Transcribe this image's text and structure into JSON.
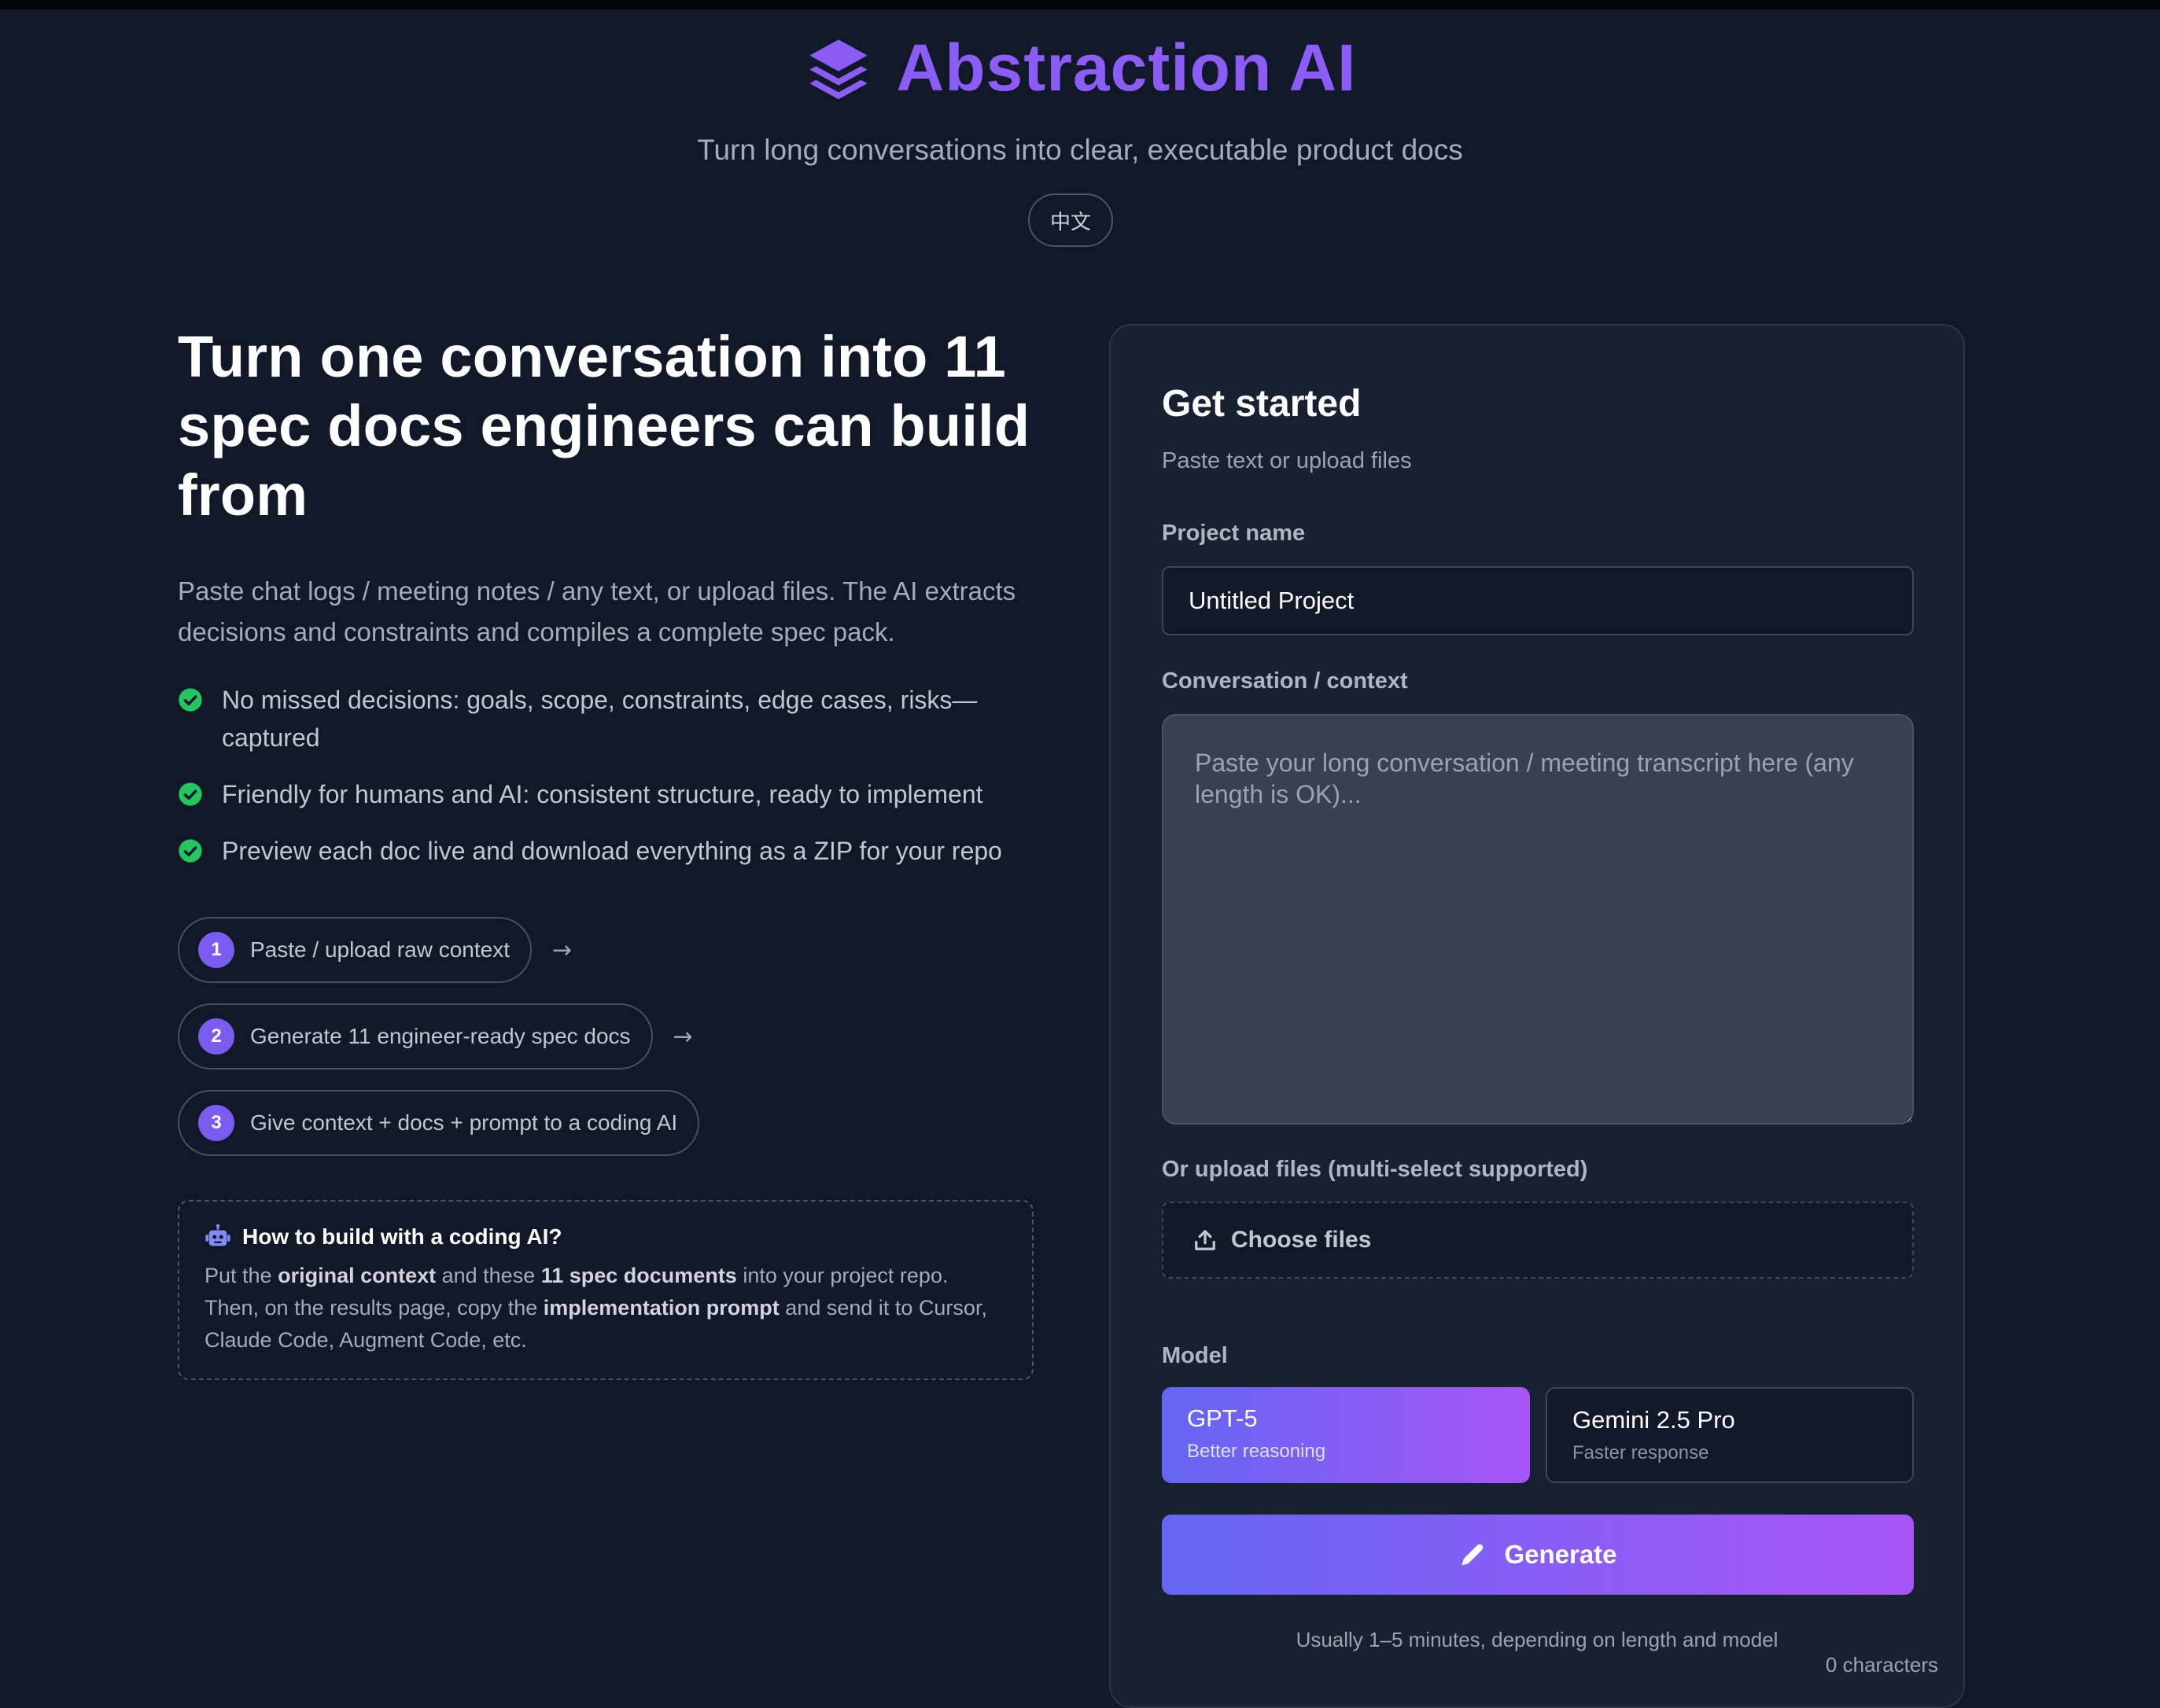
{
  "header": {
    "brand_name": "Abstraction AI",
    "tagline": "Turn long conversations into clear, executable product docs",
    "language_toggle": "中文"
  },
  "hero": {
    "title": "Turn one conversation into 11 spec docs engineers can build from",
    "subtitle": "Paste chat logs / meeting notes / any text, or upload files. The AI extracts decisions and constraints and compiles a complete spec pack.",
    "features": [
      "No missed decisions: goals, scope, constraints, edge cases, risks—captured",
      "Friendly for humans and AI: consistent structure, ready to implement",
      "Preview each doc live and download everything as a ZIP for your repo"
    ],
    "steps": [
      {
        "number": "1",
        "label": "Paste / upload raw context"
      },
      {
        "number": "2",
        "label": "Generate 11 engineer-ready spec docs"
      },
      {
        "number": "3",
        "label": "Give context + docs + prompt to a coding AI"
      }
    ],
    "arrow": "→"
  },
  "how_to": {
    "title": "How to build with a coding AI?",
    "text_1": "Put the ",
    "bold_1": "original context",
    "text_2": " and these ",
    "bold_2": "11 spec documents",
    "text_3": " into your project repo. Then, on the results page, copy the ",
    "bold_3": "implementation prompt",
    "text_4": " and send it to Cursor, Claude Code, Augment Code, etc."
  },
  "form": {
    "title": "Get started",
    "subtitle": "Paste text or upload files",
    "project_name_label": "Project name",
    "project_name_value": "Untitled Project",
    "context_label": "Conversation / context",
    "context_placeholder": "Paste your long conversation / meeting transcript here (any length is OK)...",
    "upload_label": "Or upload files (multi-select supported)",
    "upload_button": "Choose files",
    "model_label": "Model",
    "models": [
      {
        "name": "GPT-5",
        "description": "Better reasoning",
        "selected": true
      },
      {
        "name": "Gemini 2.5 Pro",
        "description": "Faster response",
        "selected": false
      }
    ],
    "generate_button": "Generate",
    "hint": "Usually 1–5 minutes, depending on length and model",
    "char_count": "0 characters"
  },
  "colors": {
    "background": "#111827",
    "accent": "#8b5cf6",
    "accent_start": "#6366f1",
    "check_green": "#22c55e"
  },
  "icons": [
    "layers-logo-icon",
    "check-circle-icon",
    "arrow-right-icon",
    "robot-icon",
    "upload-icon",
    "pencil-icon"
  ]
}
